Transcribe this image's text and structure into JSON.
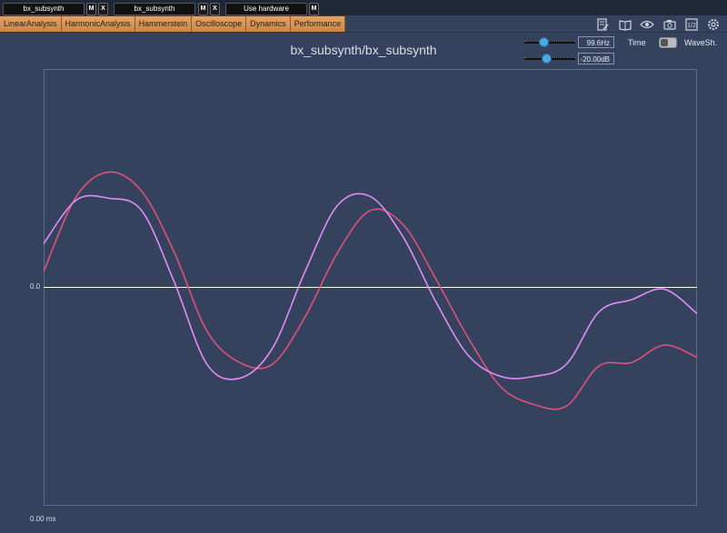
{
  "slots": {
    "slot1": {
      "label": "bx_subsynth",
      "m": "M",
      "x": "X"
    },
    "slot2": {
      "label": "bx_subsynth",
      "m": "M",
      "x": "X"
    },
    "slot3": {
      "label": "Use hardware",
      "m": "M"
    }
  },
  "tabs": [
    "LinearAnalysis",
    "HarmonicAnalysis",
    "Hammerstein",
    "Oscilloscope",
    "Dynamics",
    "Performance"
  ],
  "toolbar_icons": [
    "notes-icon",
    "book-icon",
    "eye-icon",
    "camera-icon",
    "half-icon",
    "gear-icon"
  ],
  "title": "bx_subsynth/bx_subsynth",
  "controls": {
    "frequency": {
      "value": "99.6Hz",
      "slider_fraction": 0.35
    },
    "gain": {
      "value": "-20.00dB",
      "slider_fraction": 0.4
    },
    "time_label": "Time",
    "waveshaper_label": "WaveSh."
  },
  "axis": {
    "zero_label": "0.0",
    "time_label": "0.00 ms"
  },
  "colors": {
    "background": "#34425e",
    "series_red": "#e0507a",
    "series_violet": "#e28cf6",
    "zero_line": "#ffffff"
  },
  "chart_data": {
    "type": "line",
    "xlim": [
      0,
      10
    ],
    "ylim": [
      -1.25,
      1.25
    ],
    "series": [
      {
        "color": "#e0507a",
        "x": [
          0,
          0.5,
          1,
          1.5,
          2,
          2.5,
          3,
          3.5,
          4,
          4.5,
          5,
          5.5,
          6,
          6.5,
          7,
          7.5,
          8,
          8.5,
          9,
          9.5,
          10
        ],
        "y": [
          0.09,
          0.52,
          0.66,
          0.55,
          0.2,
          -0.25,
          -0.43,
          -0.44,
          -0.17,
          0.2,
          0.44,
          0.36,
          0.05,
          -0.29,
          -0.57,
          -0.67,
          -0.68,
          -0.45,
          -0.43,
          -0.33,
          -0.4
        ]
      },
      {
        "color": "#e28cf6",
        "x": [
          0,
          0.5,
          1,
          1.5,
          2,
          2.5,
          3,
          3.5,
          4,
          4.5,
          5,
          5.5,
          6,
          6.5,
          7,
          7.5,
          8,
          8.5,
          9,
          9.5,
          10
        ],
        "y": [
          0.25,
          0.5,
          0.51,
          0.44,
          0.03,
          -0.44,
          -0.52,
          -0.35,
          0.09,
          0.47,
          0.52,
          0.29,
          -0.08,
          -0.39,
          -0.51,
          -0.51,
          -0.44,
          -0.14,
          -0.07,
          -0.01,
          -0.15
        ]
      }
    ]
  }
}
